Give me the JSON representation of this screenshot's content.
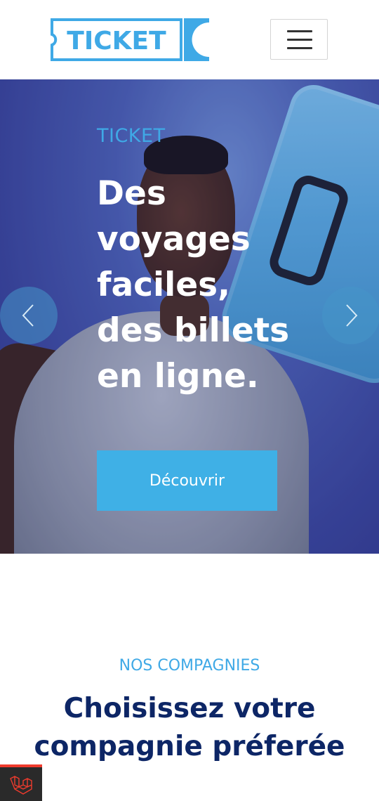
{
  "header": {
    "logo_text": "TICKET",
    "menu_icon": "hamburger-menu-icon"
  },
  "hero": {
    "kicker": "TICKET",
    "title_lines": [
      "Des",
      "voyages",
      "faciles,",
      "des billets",
      "en ligne."
    ],
    "cta_label": "Découvrir",
    "prev_icon": "chevron-left-icon",
    "next_icon": "chevron-right-icon"
  },
  "section": {
    "kicker": "NOS COMPAGNIES",
    "title_lines": [
      "Choisissez votre",
      "compagnie préferée"
    ]
  },
  "colors": {
    "accent": "#3fb0e6",
    "brand_dark": "#0d2666",
    "logo_blue": "#3fa9e6"
  },
  "badge_icon": "laravel-icon"
}
